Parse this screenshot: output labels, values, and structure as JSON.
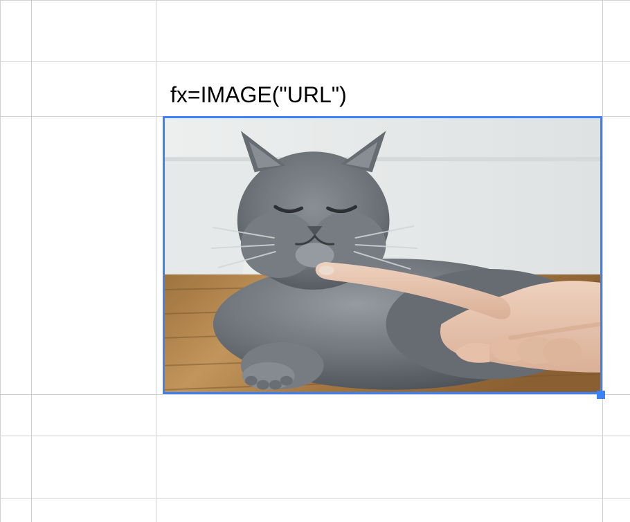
{
  "grid": {
    "hLines": [
      0,
      88,
      168,
      570,
      630,
      720
    ],
    "vLines": [
      0,
      45,
      225,
      870,
      910
    ]
  },
  "formula": {
    "text": "fx=IMAGE(\"URL\")"
  },
  "selectedCell": {
    "imageAlt": "grey-cat-chin-scratch-image"
  },
  "colors": {
    "selection": "#3b82f6",
    "gridLine": "#d0d0d0"
  }
}
